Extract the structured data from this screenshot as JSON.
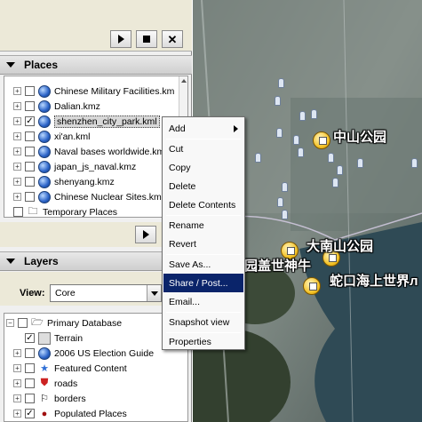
{
  "toolbar": {
    "play_icon": "play-icon",
    "stop_icon": "stop-icon",
    "close_icon": "close-icon"
  },
  "places": {
    "title": "Places",
    "items": [
      {
        "label": "Chinese Military Facilities.km",
        "checked": false
      },
      {
        "label": "Dalian.kmz",
        "checked": false
      },
      {
        "label": "shenzhen_city_park.kml",
        "checked": true,
        "selected": true
      },
      {
        "label": "xi'an.kml",
        "checked": false
      },
      {
        "label": "Naval bases worldwide.km",
        "checked": false
      },
      {
        "label": "japan_js_naval.kmz",
        "checked": false
      },
      {
        "label": "shenyang.kmz",
        "checked": false
      },
      {
        "label": "Chinese Nuclear Sites.kmz",
        "checked": false
      }
    ],
    "temporary": "Temporary Places"
  },
  "layers": {
    "title": "Layers",
    "view_label": "View:",
    "view_value": "Core",
    "items": [
      {
        "label": "Primary Database",
        "icon": "database-icon"
      },
      {
        "label": "Terrain",
        "icon": "terrain-icon"
      },
      {
        "label": "2006 US Election Guide",
        "icon": "election-globe-icon"
      },
      {
        "label": "Featured Content",
        "icon": "star-icon"
      },
      {
        "label": "roads",
        "icon": "road-sign-icon"
      },
      {
        "label": "borders",
        "icon": "flag-icon"
      },
      {
        "label": "Populated Places",
        "icon": "dot-icon"
      }
    ]
  },
  "menu": {
    "items": [
      "Add",
      "Cut",
      "Copy",
      "Delete",
      "Delete Contents",
      "Rename",
      "Revert",
      "Save As...",
      "Share / Post...",
      "Email...",
      "Snapshot view",
      "Properties"
    ],
    "highlighted": "Share / Post..."
  },
  "map": {
    "labels": [
      "中山公园",
      "大南山公园",
      "园盖世神牛",
      "蛇口海上世界л"
    ]
  }
}
